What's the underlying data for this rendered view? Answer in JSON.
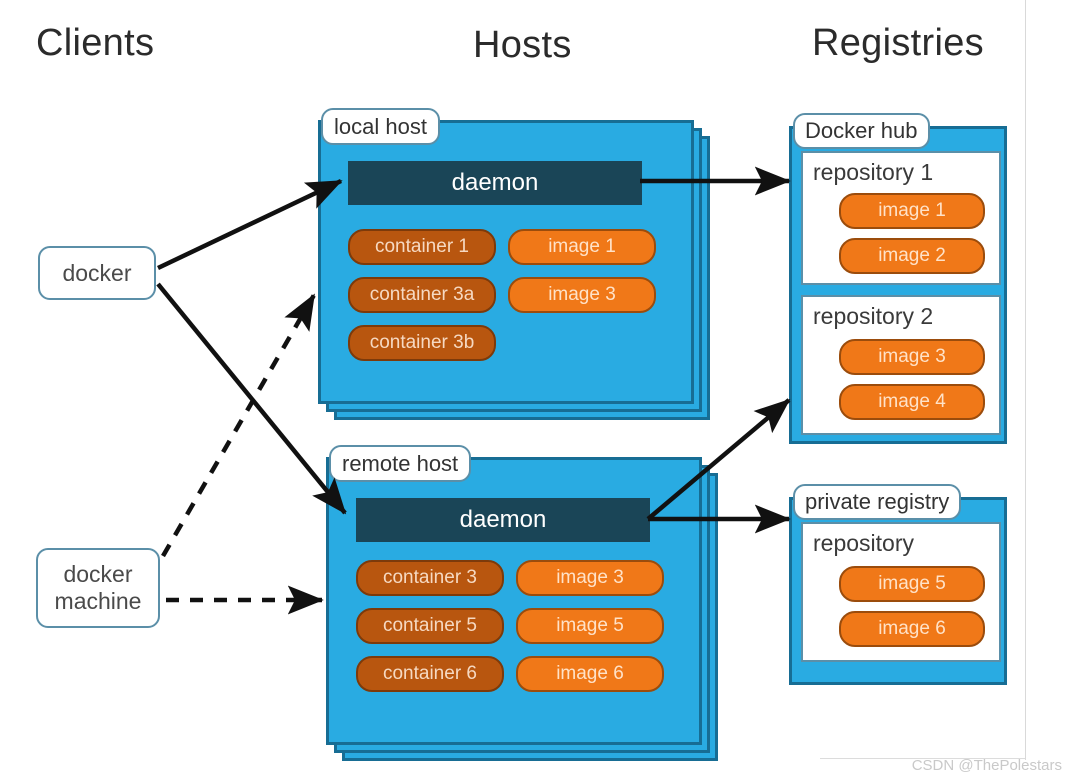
{
  "columns": {
    "clients": "Clients",
    "hosts": "Hosts",
    "registries": "Registries"
  },
  "clients": [
    {
      "id": "docker",
      "label": "docker"
    },
    {
      "id": "docker-machine",
      "label": "docker machine"
    }
  ],
  "hosts": [
    {
      "id": "local-host",
      "label": "local host",
      "daemon": "daemon",
      "containers": [
        "container 1",
        "container 3a",
        "container 3b"
      ],
      "images": [
        "image 1",
        "image 3"
      ]
    },
    {
      "id": "remote-host",
      "label": "remote host",
      "daemon": "daemon",
      "containers": [
        "container 3",
        "container 5",
        "container 6"
      ],
      "images": [
        "image 3",
        "image 5",
        "image 6"
      ]
    }
  ],
  "registries": [
    {
      "id": "docker-hub",
      "label": "Docker hub",
      "repositories": [
        {
          "title": "repository 1",
          "images": [
            "image 1",
            "image 2"
          ]
        },
        {
          "title": "repository 2",
          "images": [
            "image 3",
            "image 4"
          ]
        }
      ]
    },
    {
      "id": "private-registry",
      "label": "private registry",
      "repositories": [
        {
          "title": "repository",
          "images": [
            "image 5",
            "image 6"
          ]
        }
      ]
    }
  ],
  "connections": [
    {
      "id": "docker-to-local-daemon",
      "from": "docker",
      "to": "local host daemon",
      "style": "solid"
    },
    {
      "id": "docker-to-remote-daemon",
      "from": "docker",
      "to": "remote host daemon",
      "style": "solid"
    },
    {
      "id": "machine-to-local-host",
      "from": "docker machine",
      "to": "local host",
      "style": "dashed"
    },
    {
      "id": "machine-to-remote-host",
      "from": "docker machine",
      "to": "remote host",
      "style": "dashed"
    },
    {
      "id": "local-daemon-to-repository-1",
      "from": "local host daemon",
      "to": "repository 1",
      "style": "solid"
    },
    {
      "id": "remote-daemon-to-repository-2",
      "from": "remote host daemon",
      "to": "repository 2",
      "style": "solid"
    },
    {
      "id": "remote-daemon-to-private-registry",
      "from": "remote host daemon",
      "to": "private registry",
      "style": "solid"
    }
  ],
  "watermark": "CSDN @ThePolestars",
  "colors": {
    "host_blue": "#29ABE2",
    "host_border": "#176d94",
    "daemon_navy": "#1a4557",
    "container_brown": "#B8560F",
    "image_orange": "#F07818",
    "label_border": "#5b8fa8",
    "arrow_black": "#111111"
  }
}
